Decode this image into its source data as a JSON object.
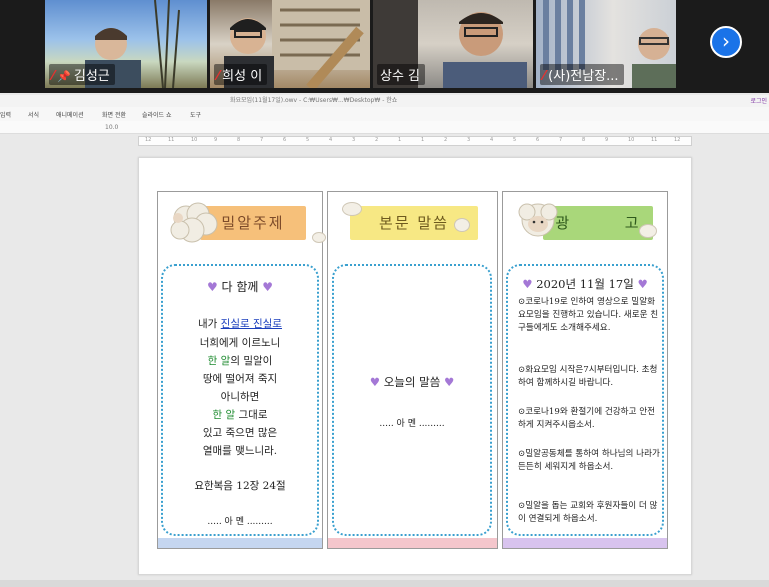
{
  "participants": [
    {
      "name": "김성근",
      "pinned": true,
      "muted": true
    },
    {
      "name": "희성 이",
      "pinned": false,
      "muted": true
    },
    {
      "name": "상수 김",
      "pinned": false,
      "muted": false
    },
    {
      "name": "(사)전남장...",
      "pinned": false,
      "muted": true
    }
  ],
  "editor": {
    "title": "화요모임(11월17일).owv - C:₩Users₩...₩Desktop₩ - 한쇼",
    "login": "로그인",
    "menu": [
      "입력",
      "서식",
      "애니메이션",
      "화면 전환",
      "슬라이드 쇼",
      "도구"
    ],
    "toolbar_hint": "10.0",
    "ruler": [
      "12",
      "11",
      "10",
      "9",
      "8",
      "7",
      "6",
      "5",
      "4",
      "3",
      "2",
      "1",
      "1",
      "2",
      "3",
      "4",
      "5",
      "6",
      "7",
      "8",
      "9",
      "10",
      "11",
      "12"
    ]
  },
  "panel1": {
    "banner": "밀알주제",
    "heading": "다 함께",
    "lines": {
      "l1a": "내가",
      "l1b": "진실로 진실로",
      "l2": "너희에게 이르노니",
      "l3a": "한 알",
      "l3b": "의 밀알이",
      "l4": "땅에 떨어져 죽지",
      "l5": "아니하면",
      "l6a": "한 알",
      "l6b": " 그대로",
      "l7": "있고 죽으면 많은",
      "l8": "열매를 맺느니라."
    },
    "reference": "요한복음 12장 24절",
    "amen": "..... 아 멘 ........."
  },
  "panel2": {
    "banner": "본문 말씀",
    "todays_word": "오늘의 말씀",
    "amen": "..... 아 멘 ........."
  },
  "panel3": {
    "banner_a": "광",
    "banner_b": "고",
    "date": "2020년 11월 17일",
    "items": [
      "⊙코로나19로 인하여 영상으로 밀알화요모임을 진행하고 있습니다. 새로운 친구들에게도 소개해주세요.",
      "⊙화요모임 시작은7시부터입니다. 초청하여 함께하시길 바랍니다.",
      "⊙코로나19와 환절기에 건강하고 안전하게 지켜주시옵소서.",
      "⊙밀알공동체를 통하여 하나님의 나라가 든든히 세워지게 하옵소서.",
      "⊙밀알을 돕는 교회와 후원자들이 더 많이 연결되게 하옵소서."
    ]
  },
  "colors": {
    "banner1": "#f6c07a",
    "banner2": "#f7e884",
    "banner3": "#a9d77a",
    "foot1": "#c5d6f0",
    "foot2": "#f4c6cc",
    "foot3": "#d8c3ee",
    "dotted_border": "#3aa0cf",
    "heart": "#a478d6"
  },
  "icons": [
    "mic-muted-icon",
    "pin-icon",
    "chevron-right-icon",
    "sheep-icon",
    "cloud-icon",
    "heart-icon"
  ]
}
